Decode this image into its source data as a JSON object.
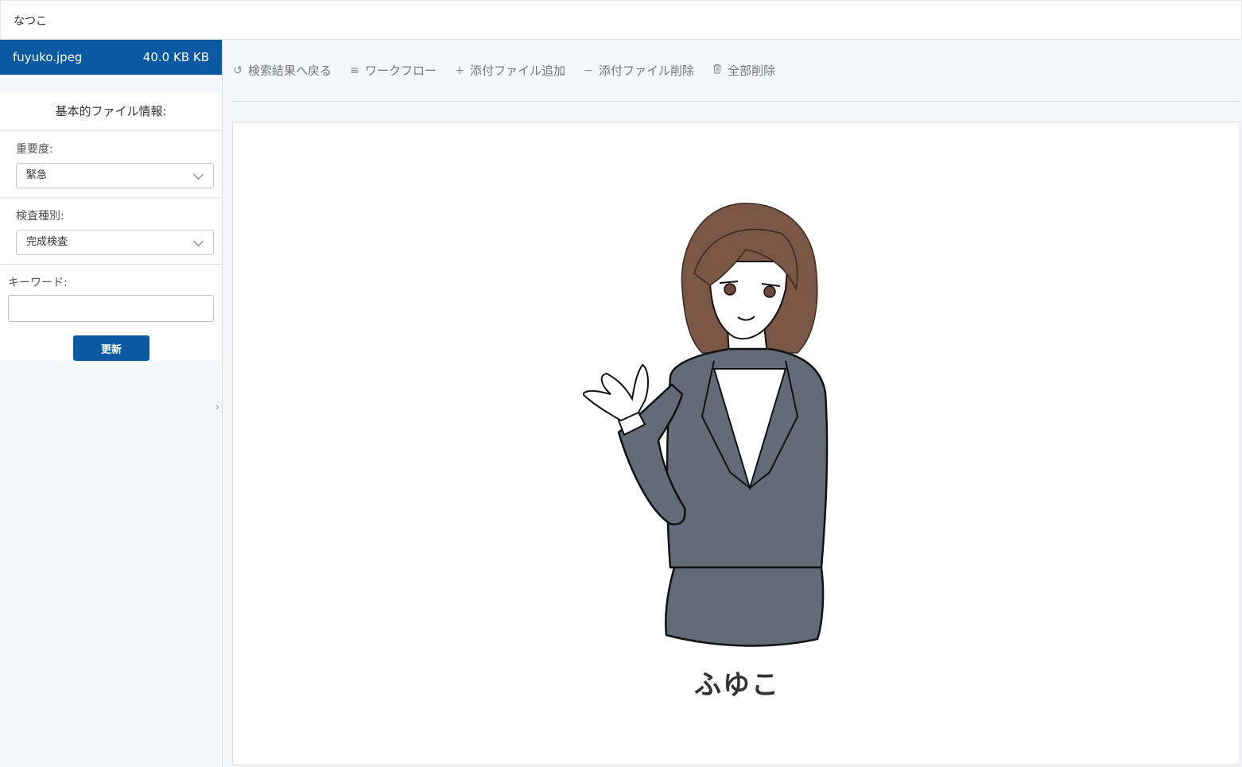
{
  "topbar": {
    "user_name": "なつこ"
  },
  "file": {
    "name": "fuyuko.jpeg",
    "size": "40.0 KB KB"
  },
  "info_panel": {
    "title": "基本的ファイル情報:",
    "importance_label": "重要度:",
    "importance_value": "緊急",
    "inspection_label": "検査種別:",
    "inspection_value": "完成検査",
    "keyword_label": "キーワード:",
    "keyword_value": "",
    "update_label": "更新"
  },
  "toolbar": {
    "back_label": "検索結果へ戻る",
    "workflow_label": "ワークフロー",
    "add_label": "添付ファイル追加",
    "remove_label": "添付ファイル削除",
    "delete_all_label": "全部削除"
  },
  "viewer": {
    "caption": "ふゆこ"
  },
  "colors": {
    "primary": "#0a5aa3",
    "hair": "#7a5645",
    "suit": "#646b78"
  },
  "icons": {
    "back": "undo-icon",
    "workflow": "list-icon",
    "add": "plus-icon",
    "remove": "minus-icon",
    "delete_all": "trash-icon"
  }
}
